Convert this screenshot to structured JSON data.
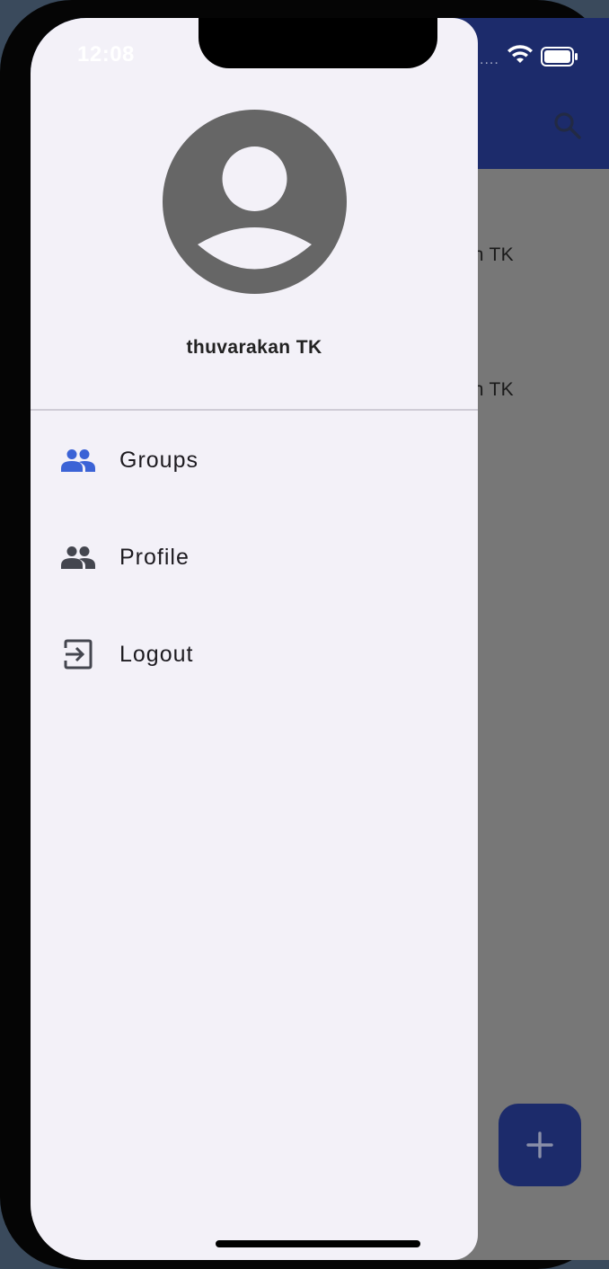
{
  "status_bar": {
    "time": "12:08"
  },
  "drawer": {
    "user": {
      "name": "thuvarakan TK"
    },
    "menu": [
      {
        "label": "Groups",
        "icon": "group-icon",
        "selected": true
      },
      {
        "label": "Profile",
        "icon": "group-icon",
        "selected": false
      },
      {
        "label": "Logout",
        "icon": "logout-icon",
        "selected": false
      }
    ]
  },
  "background_list": {
    "items": [
      {
        "text": "kan TK"
      },
      {
        "text": "kan TK"
      }
    ]
  },
  "fab": {
    "icon": "plus-icon"
  },
  "colors": {
    "primary": "#1c2b6b",
    "selected_icon": "#3b63d6",
    "drawer_bg": "#f3f1f8",
    "scrim_content": "#777777"
  }
}
